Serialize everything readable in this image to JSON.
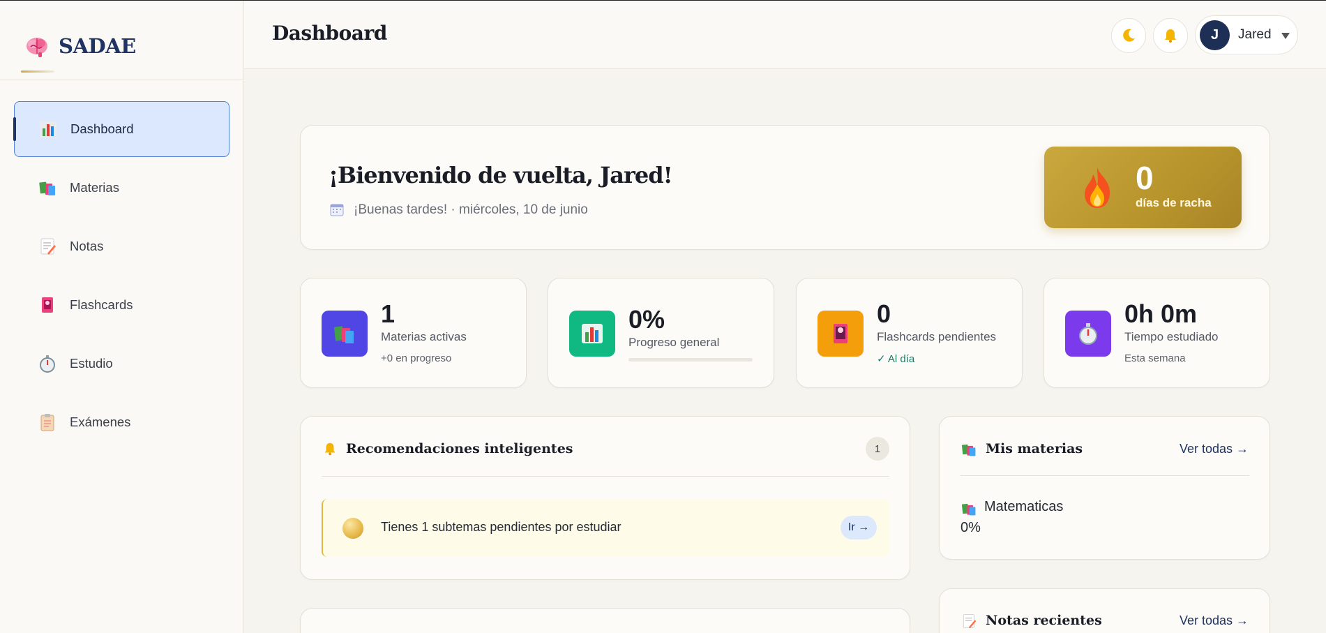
{
  "brand": {
    "name": "SADAE"
  },
  "sidebar": {
    "items": [
      {
        "label": "Dashboard",
        "icon": "bar-chart-icon"
      },
      {
        "label": "Materias",
        "icon": "books-icon"
      },
      {
        "label": "Notas",
        "icon": "memo-icon"
      },
      {
        "label": "Flashcards",
        "icon": "card-icon"
      },
      {
        "label": "Estudio",
        "icon": "stopwatch-icon"
      },
      {
        "label": "Exámenes",
        "icon": "clipboard-icon"
      }
    ],
    "active_index": 0
  },
  "header": {
    "title": "Dashboard",
    "user": {
      "initial": "J",
      "name": "Jared"
    }
  },
  "welcome": {
    "title": "¡Bienvenido de vuelta, Jared!",
    "subtitle": "¡Buenas tardes! · miércoles, 10 de junio",
    "streak": {
      "value": "0",
      "label": "días de racha"
    }
  },
  "stats": [
    {
      "value": "1",
      "label": "Materias activas",
      "sub": "+0 en progreso",
      "color": "#4f46e5"
    },
    {
      "value": "0%",
      "label": "Progreso general",
      "progress": 0,
      "color": "#10b981"
    },
    {
      "value": "0",
      "label": "Flashcards pendientes",
      "sub": "✓ Al día",
      "color": "#f59e0b"
    },
    {
      "value": "0h 0m",
      "label": "Tiempo estudiado",
      "sub": "Esta semana",
      "color": "#7c3aed"
    }
  ],
  "recommendations": {
    "title": "Recomendaciones inteligentes",
    "count": "1",
    "items": [
      {
        "text": "Tienes 1 subtemas pendientes por estudiar",
        "action": "Ir →"
      }
    ]
  },
  "subjects": {
    "title": "Mis materias",
    "link": "Ver todas →",
    "items": [
      {
        "name": "Matematicas",
        "progress": "0%"
      }
    ]
  },
  "recent_notes": {
    "title": "Notas recientes",
    "link": "Ver todas →"
  }
}
